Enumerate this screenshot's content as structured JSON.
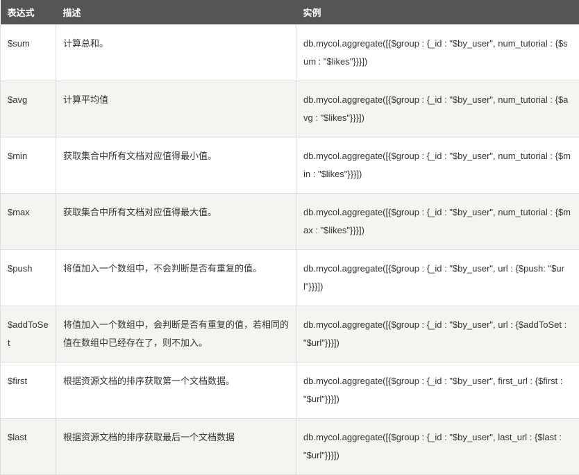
{
  "headers": {
    "expression": "表达式",
    "description": "描述",
    "example": "实例"
  },
  "rows": [
    {
      "expression": "$sum",
      "description": "计算总和。",
      "example": "db.mycol.aggregate([{$group : {_id : \"$by_user\", num_tutorial : {$sum : \"$likes\"}}}])"
    },
    {
      "expression": "$avg",
      "description": "计算平均值",
      "example": "db.mycol.aggregate([{$group : {_id : \"$by_user\", num_tutorial : {$avg : \"$likes\"}}}])"
    },
    {
      "expression": "$min",
      "description": "获取集合中所有文档对应值得最小值。",
      "example": "db.mycol.aggregate([{$group : {_id : \"$by_user\", num_tutorial : {$min : \"$likes\"}}}])"
    },
    {
      "expression": "$max",
      "description": "获取集合中所有文档对应值得最大值。",
      "example": "db.mycol.aggregate([{$group : {_id : \"$by_user\", num_tutorial : {$max : \"$likes\"}}}])"
    },
    {
      "expression": "$push",
      "description": "将值加入一个数组中，不会判断是否有重复的值。",
      "example": "db.mycol.aggregate([{$group : {_id : \"$by_user\", url : {$push: \"$url\"}}}])"
    },
    {
      "expression": "$addToSet",
      "description": "将值加入一个数组中，会判断是否有重复的值，若相同的值在数组中已经存在了，则不加入。",
      "example": "db.mycol.aggregate([{$group : {_id : \"$by_user\", url : {$addToSet : \"$url\"}}}])"
    },
    {
      "expression": "$first",
      "description": "根据资源文档的排序获取第一个文档数据。",
      "example": "db.mycol.aggregate([{$group : {_id : \"$by_user\", first_url : {$first : \"$url\"}}}])"
    },
    {
      "expression": "$last",
      "description": "根据资源文档的排序获取最后一个文档数据",
      "example": "db.mycol.aggregate([{$group : {_id : \"$by_user\", last_url : {$last : \"$url\"}}}])"
    }
  ]
}
